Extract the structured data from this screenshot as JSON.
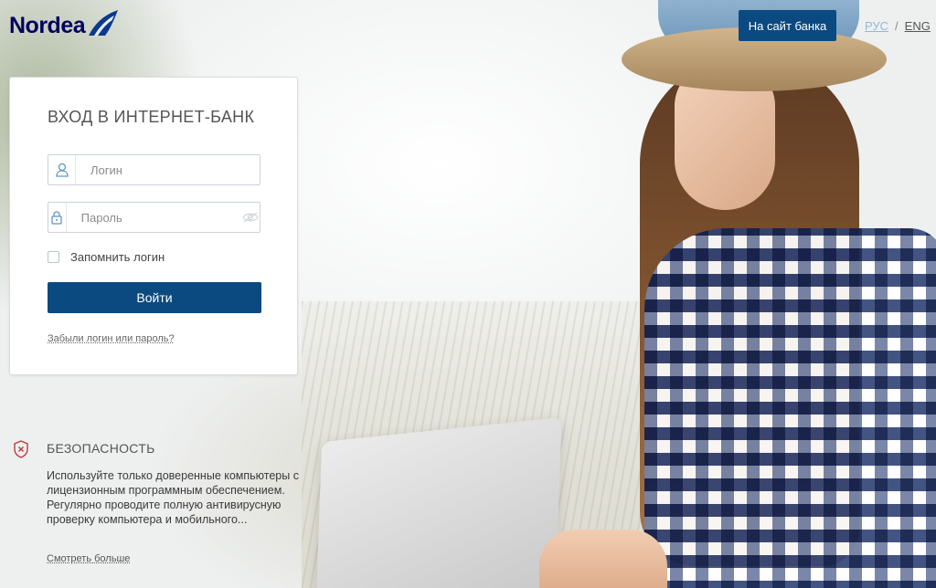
{
  "brand": {
    "logo_text": "Nordea",
    "primary_color": "#0a4a80"
  },
  "header": {
    "bank_site_button": "На сайт банка",
    "lang_ru": "РУС",
    "lang_sep": "/",
    "lang_en": "ENG"
  },
  "login": {
    "title": "ВХОД В ИНТЕРНЕТ-БАНК",
    "login_placeholder": "Логин",
    "password_placeholder": "Пароль",
    "remember_label": "Запомнить логин",
    "submit_label": "Войти",
    "forgot_link": "Забыли логин или пароль?",
    "icons": {
      "login": "user-icon",
      "password": "lock-icon",
      "toggle": "eye-icon"
    }
  },
  "security": {
    "icon": "shield-icon",
    "title": "БЕЗОПАСНОСТЬ",
    "text": "Используйте только доверенные компьютеры с лицензионным программным обеспечением. Регулярно проводите полную антивирусную проверку компьютера и мобильного...",
    "more_link": "Смотреть больше"
  }
}
